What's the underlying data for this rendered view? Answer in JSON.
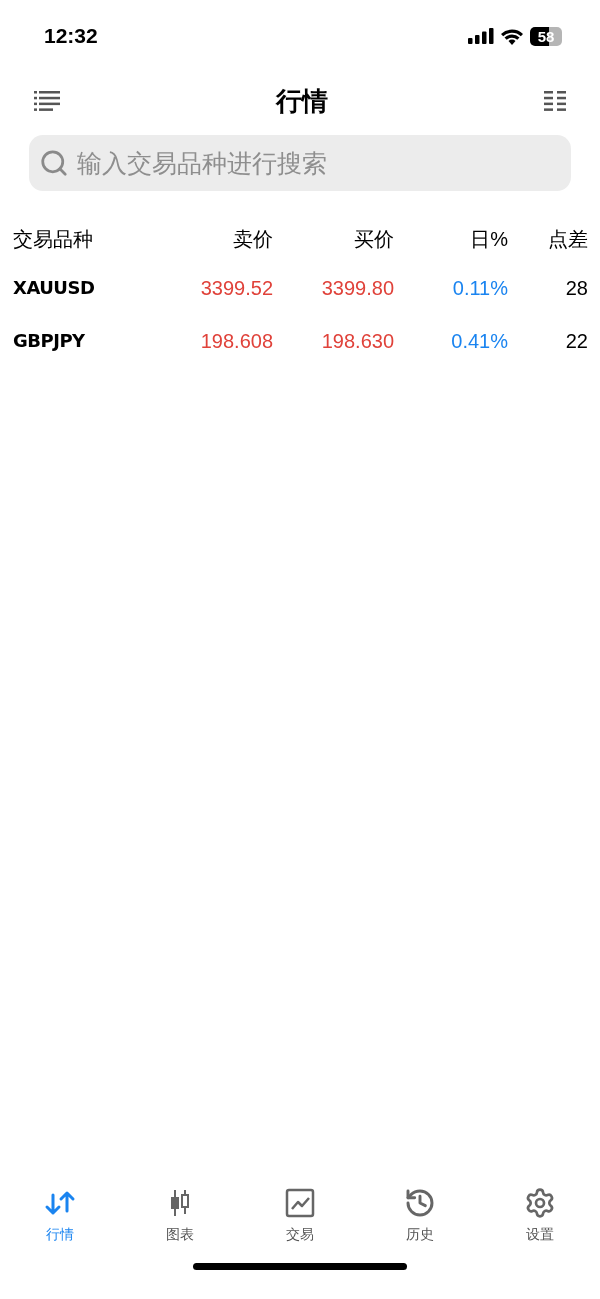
{
  "status_bar": {
    "time": "12:32",
    "battery": "58"
  },
  "header": {
    "title": "行情"
  },
  "search": {
    "placeholder": "输入交易品种进行搜索"
  },
  "table": {
    "columns": [
      "交易品种",
      "卖价",
      "买价",
      "日%",
      "点差"
    ],
    "rows": [
      {
        "symbol": "XAUUSD",
        "bid": "3399.52",
        "ask": "3399.80",
        "change": "0.11%",
        "spread": "28"
      },
      {
        "symbol": "GBPJPY",
        "bid": "198.608",
        "ask": "198.630",
        "change": "0.41%",
        "spread": "22"
      }
    ]
  },
  "tab_bar": [
    {
      "kind": "quotes",
      "label": "行情",
      "selected": true
    },
    {
      "kind": "chart",
      "label": "图表",
      "selected": false
    },
    {
      "kind": "trade",
      "label": "交易",
      "selected": false
    },
    {
      "kind": "history",
      "label": "历史",
      "selected": false
    },
    {
      "kind": "settings",
      "label": "设置",
      "selected": false
    }
  ]
}
